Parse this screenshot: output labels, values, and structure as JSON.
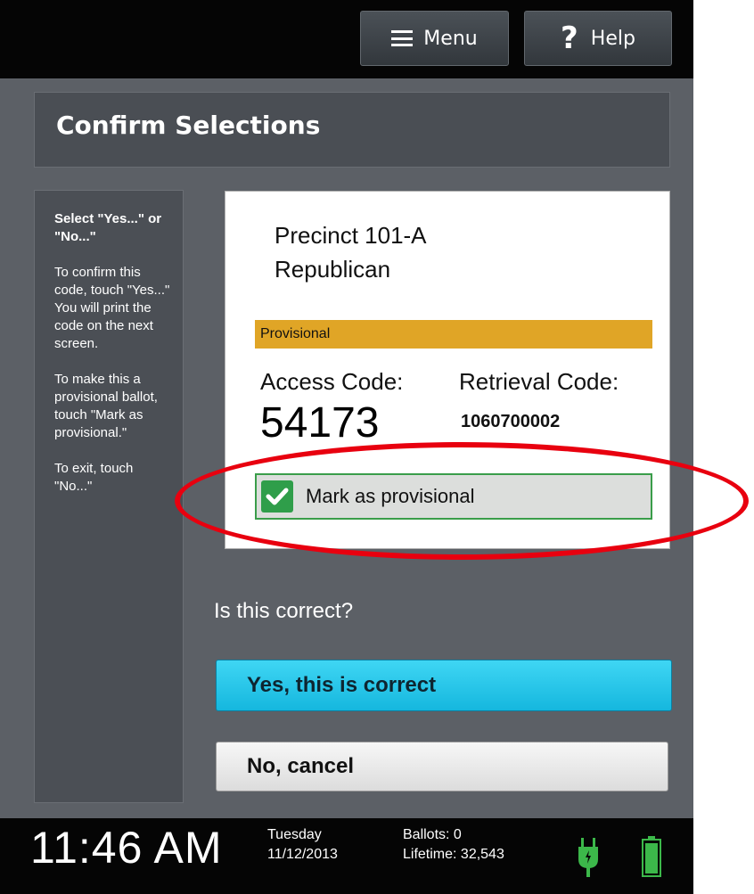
{
  "topbar": {
    "menu_label": "Menu",
    "help_label": "Help",
    "help_symbol": "?"
  },
  "title": "Confirm Selections",
  "instructions": {
    "heading": "Select \"Yes...\" or \"No...\"",
    "para1": "To confirm this code, touch \"Yes...\" You will print the code on the next screen.",
    "para2": "To make this a provisional ballot, touch \"Mark as provisional.\"",
    "para3": "To exit, touch \"No...\""
  },
  "card": {
    "precinct": "Precinct 101-A",
    "party": "Republican",
    "status_bar": "Provisional",
    "status_color": "#e0a526",
    "access_label": "Access Code:",
    "access_code": "54173",
    "retrieval_label": "Retrieval Code:",
    "retrieval_code": "1060700002",
    "mark_label": "Mark as provisional",
    "mark_checked": true
  },
  "question": "Is this correct?",
  "buttons": {
    "yes": "Yes, this is correct",
    "no": "No, cancel"
  },
  "status": {
    "time": "11:46 AM",
    "day": "Tuesday",
    "date": "11/12/2013",
    "ballots": "Ballots:  0",
    "lifetime": "Lifetime: 32,543"
  },
  "icons": [
    "menu-icon",
    "help-icon",
    "checkbox-checked-icon",
    "power-plug-icon",
    "battery-icon"
  ],
  "colors": {
    "accent_yes": "#15b7de",
    "check_green": "#2f9e4a",
    "highlight_circle": "#e8000f"
  }
}
